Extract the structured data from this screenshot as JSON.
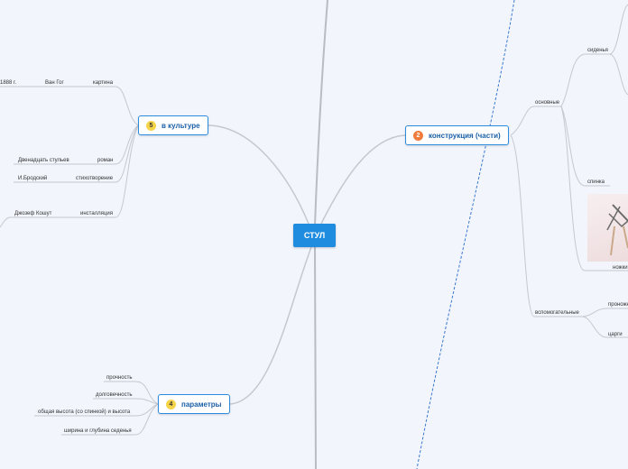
{
  "root": {
    "label": "СТУЛ"
  },
  "topics": {
    "construction": {
      "num": "2",
      "label": "конструкция (части)"
    },
    "culture": {
      "num": "5",
      "label": "в культуре"
    },
    "params": {
      "num": "4",
      "label": "параметры"
    }
  },
  "construction": {
    "main": "основные",
    "aux": "вспомогательные",
    "seat": "сиденья",
    "back": "спинка",
    "legs": "ножки",
    "stretchers": "проножки",
    "aprons": "царги"
  },
  "culture": {
    "items": [
      {
        "type": "картина",
        "name": "Ван Гог",
        "extra": "1888 г."
      },
      {
        "type": "роман",
        "name": "Двенадцать стульев"
      },
      {
        "type": "стихотворение",
        "name": "И.Бродский"
      },
      {
        "type": "инсталляция",
        "name": "Джозеф Кошут"
      }
    ]
  },
  "params": {
    "items": [
      "прочность",
      "долговечность",
      "общая высота (со спинкой) и высота",
      "ширина и глубина седенья"
    ]
  },
  "colors": {
    "root": "#1f8ce0",
    "topic_border": "#2c8de0",
    "line": "#c5c8ce",
    "dashed": "#3a78d0"
  }
}
